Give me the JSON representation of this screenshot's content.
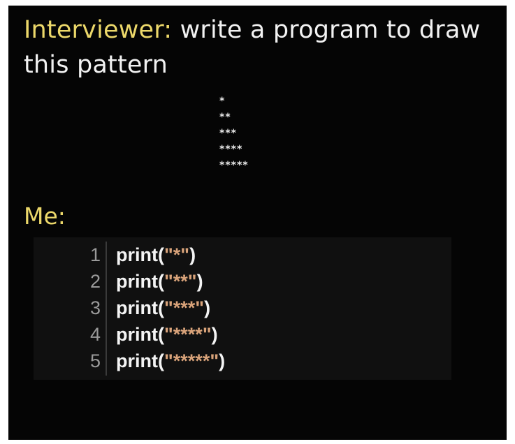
{
  "question": {
    "speaker": "Interviewer:",
    "text": " write a program to draw this pattern"
  },
  "pattern": [
    "*",
    "**",
    "***",
    "****",
    "*****"
  ],
  "answer": {
    "speaker": "Me:"
  },
  "code": [
    {
      "num": "1",
      "pre": "print(",
      "str": "\"*\"",
      "post": ")"
    },
    {
      "num": "2",
      "pre": "print(",
      "str": "\"**\"",
      "post": ")"
    },
    {
      "num": "3",
      "pre": "print(",
      "str": "\"***\"",
      "post": ")"
    },
    {
      "num": "4",
      "pre": "print(",
      "str": "\"****\"",
      "post": ")"
    },
    {
      "num": "5",
      "pre": "print(",
      "str": "\"*****\"",
      "post": ")"
    }
  ],
  "colors": {
    "background": "#050505",
    "speaker": "#ecd86a",
    "text": "#f2f2f2",
    "string_literal": "#d9a37a",
    "line_number": "#9a9a9a"
  }
}
